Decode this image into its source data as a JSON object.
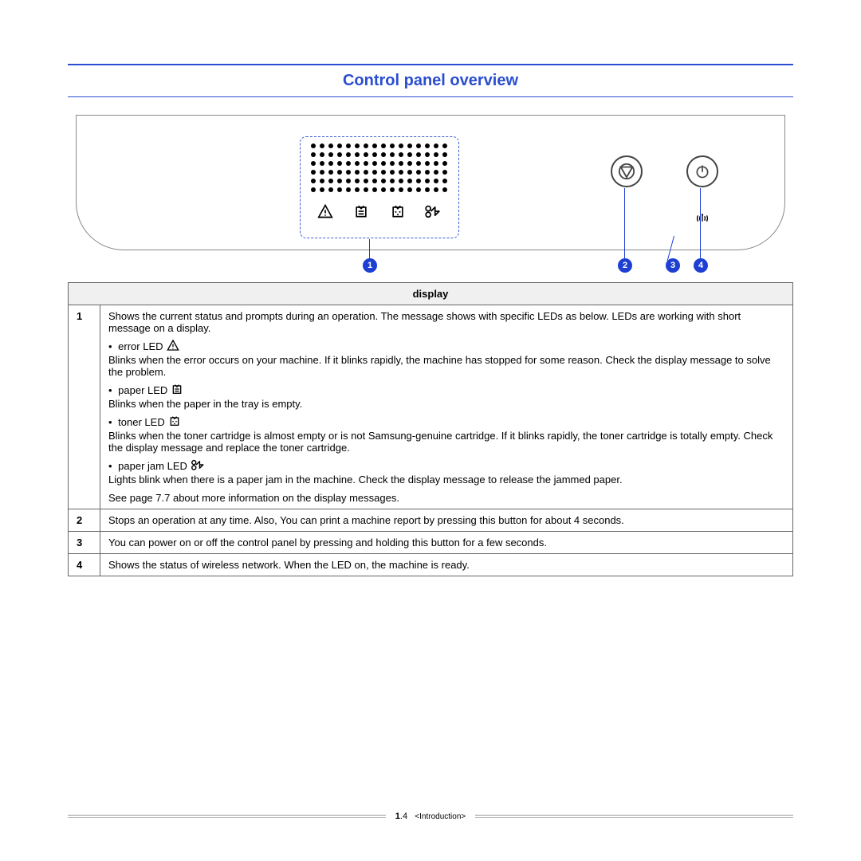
{
  "heading": "Control panel overview",
  "callouts": {
    "c1": "1",
    "c2": "2",
    "c3": "3",
    "c4": "4"
  },
  "legend": {
    "header": "display",
    "row1": {
      "num": "1",
      "intro": "Shows the current status and prompts during an operation. The message shows with specific LEDs as below. LEDs are working with short message on a display.",
      "error_label": "error LED",
      "error_desc": "Blinks when the error occurs on your machine. If it blinks rapidly, the machine has stopped for some reason. Check the display message to solve the problem.",
      "paper_label": "paper LED",
      "paper_desc": "Blinks when the paper in the tray is empty.",
      "toner_label": "toner LED",
      "toner_desc": "Blinks when the toner cartridge is almost empty or is not Samsung-genuine cartridge. If it blinks rapidly, the toner cartridge is totally empty. Check the display message and replace the toner cartridge.",
      "jam_label": "paper jam LED",
      "jam_desc": "Lights blink when there is a paper jam in the machine. Check the display message to release the jammed paper.",
      "see": "See page 7.7 about more information on the display messages."
    },
    "row2": {
      "num": "2",
      "text": "Stops an operation at any time. Also, You can print a machine report by pressing this button for about 4 seconds."
    },
    "row3": {
      "num": "3",
      "text": "You can power on or off the control panel by pressing and holding this button for a few seconds."
    },
    "row4": {
      "num": "4",
      "text": "Shows the status of wireless network. When the LED on, the machine is ready."
    }
  },
  "footer": {
    "page_chapter": "1",
    "page_sep": ".",
    "page_num": "4",
    "section": "<Introduction>"
  }
}
